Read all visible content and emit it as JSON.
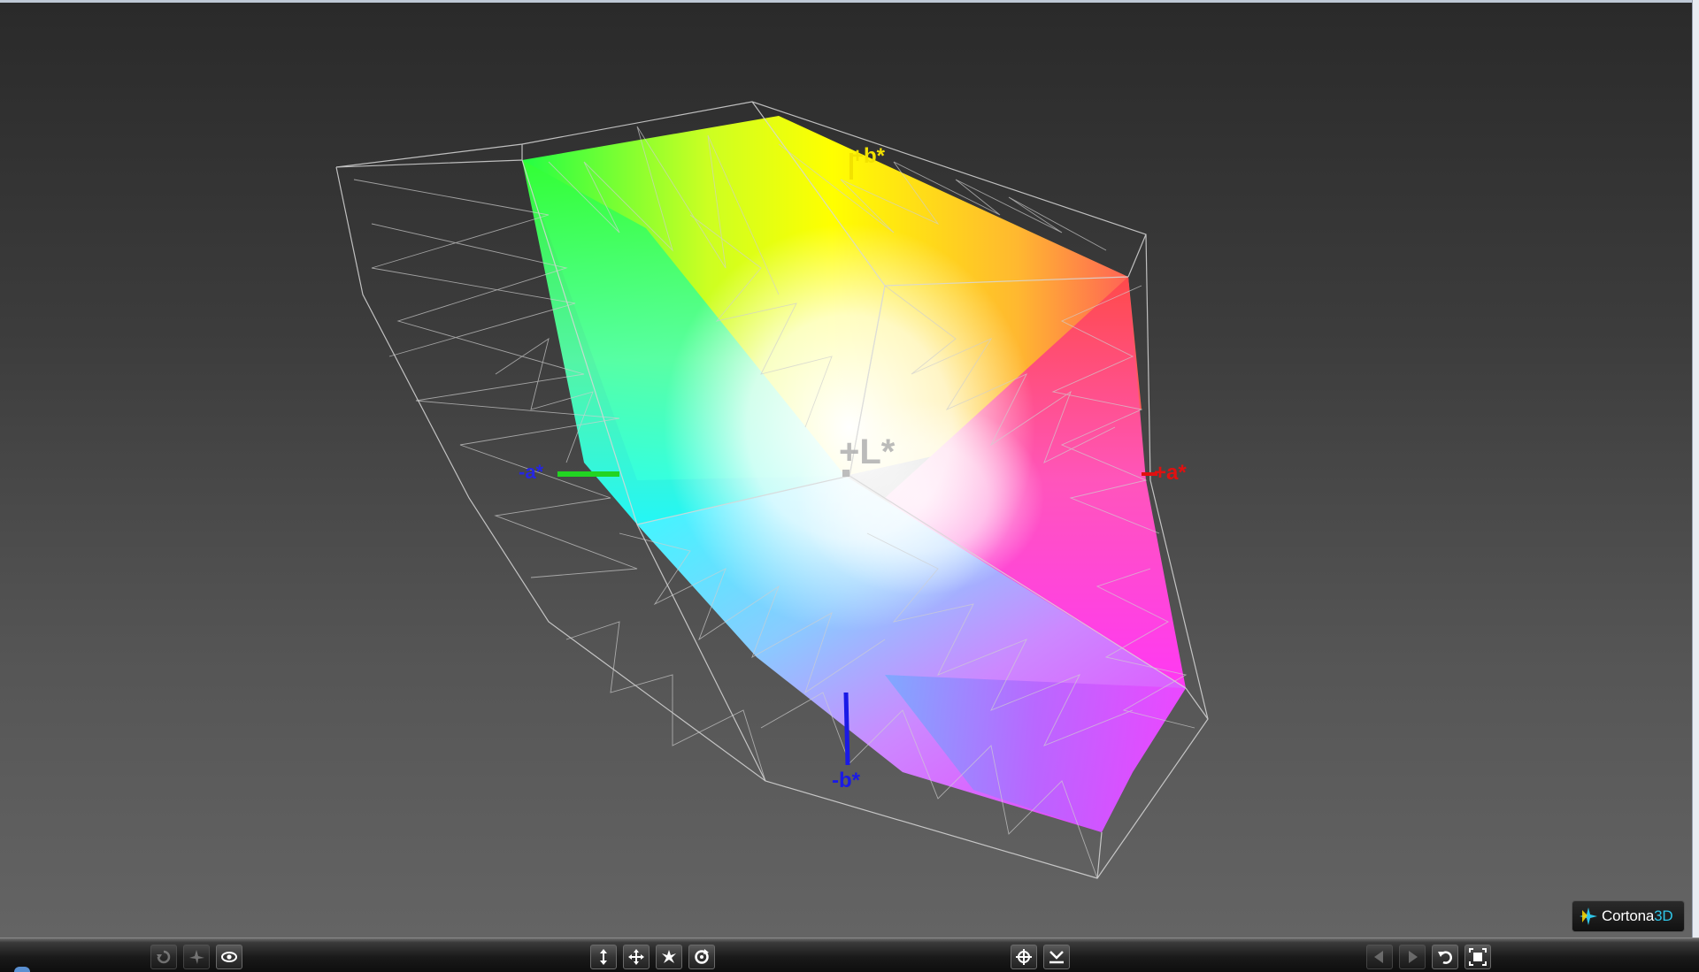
{
  "window": {
    "app": "Cortona3D viewer"
  },
  "scene": {
    "axis_labels": {
      "plus_l": "+L*",
      "plus_b": "+b*",
      "minus_a": "-a*",
      "plus_a": "+a*",
      "minus_b": "-b*"
    },
    "colors": {
      "axis_plus_b": "#f2e200",
      "axis_minus_a_line": "#22d422",
      "axis_minus_a_text": "#2626e0",
      "axis_plus_a": "#e01010",
      "axis_minus_b": "#1a1ae6",
      "axis_plus_l": "#b0b0b0",
      "wireframe": "#d8d8d8"
    }
  },
  "logo": {
    "brand": "Cortona",
    "suffix": "3D"
  },
  "toolbar": {
    "left_group": [
      {
        "name": "turn-icon",
        "enabled": false
      },
      {
        "name": "fly-icon",
        "enabled": false
      },
      {
        "name": "study-eye-icon",
        "enabled": true
      }
    ],
    "center_group": [
      {
        "name": "plan-move-icon"
      },
      {
        "name": "pan-icon"
      },
      {
        "name": "turn-navigation-icon"
      },
      {
        "name": "roll-icon"
      }
    ],
    "right_center_group": [
      {
        "name": "goto-target-icon"
      },
      {
        "name": "align-icon"
      }
    ],
    "right_group": [
      {
        "name": "previous-viewpoint-icon"
      },
      {
        "name": "next-viewpoint-icon"
      },
      {
        "name": "restore-icon"
      },
      {
        "name": "fit-icon"
      }
    ]
  }
}
